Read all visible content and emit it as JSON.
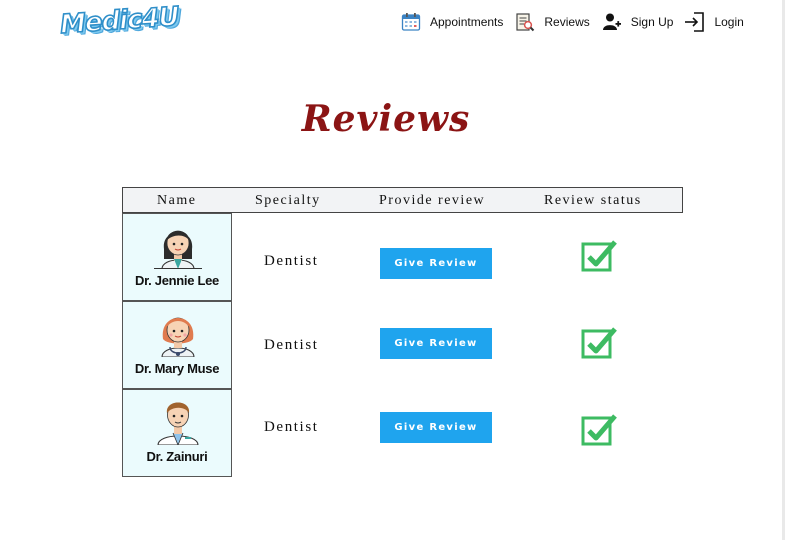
{
  "brand": {
    "logo_text": "Medic4U"
  },
  "nav": {
    "items": [
      {
        "label": "Appointments",
        "icon": "calendar-icon"
      },
      {
        "label": "Reviews",
        "icon": "review-icon"
      },
      {
        "label": "Sign Up",
        "icon": "add-user-icon"
      },
      {
        "label": "Login",
        "icon": "login-icon"
      }
    ]
  },
  "page": {
    "title": "Reviews"
  },
  "table": {
    "headers": [
      "Name",
      "Specialty",
      "Provide review",
      "Review status"
    ],
    "rows": [
      {
        "name": "Dr. Jennie Lee",
        "specialty": "Dentist",
        "button_label": "Give Review",
        "status": "reviewed",
        "avatar": "female-doctor-avatar"
      },
      {
        "name": "Dr. Mary Muse",
        "specialty": "Dentist",
        "button_label": "Give Review",
        "status": "reviewed",
        "avatar": "female-doctor-avatar"
      },
      {
        "name": "Dr. Zainuri",
        "specialty": "Dentist",
        "button_label": "Give Review",
        "status": "reviewed",
        "avatar": "male-doctor-avatar"
      }
    ]
  },
  "colors": {
    "title": "#8b1414",
    "button": "#1fa4ee",
    "check": "#3dbb62",
    "card_bg": "#ebfbfd",
    "header_bg": "#f2f3f5"
  }
}
